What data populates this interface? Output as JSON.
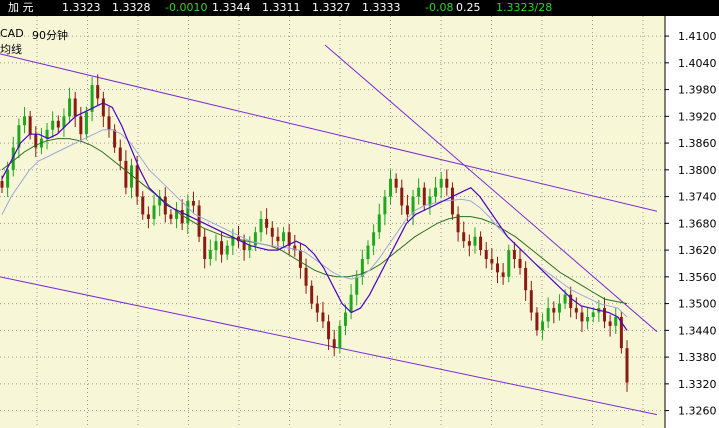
{
  "colors": {
    "background": "#f7f7d8",
    "up_candle": "#1fa81f",
    "down_candle": "#8b1a10",
    "ma_fast": "#4b00c8",
    "ma_mid": "#9fa8d8",
    "ma_slow": "#2b6e1e",
    "channel": "#7b2bd6",
    "header_text": "#ffffff",
    "header_green": "#2bd62b"
  },
  "header": {
    "symbol_cn": "加  元",
    "v1": "1.3323",
    "v2": "1.3328",
    "change": "-0.0010",
    "v3": "1.3344",
    "v4": "1.3311",
    "v5": "1.3327",
    "v6": "1.3333",
    "change_pct": "-0.08",
    "v7": "0.25",
    "v8": "1.3323/28"
  },
  "legend": {
    "pair": "CAD",
    "period": "90分钟",
    "indicator": "均线"
  },
  "chart_data": {
    "type": "candlestick",
    "y_ticks": [
      "1.4100",
      "1.4040",
      "1.3980",
      "1.3920",
      "1.3860",
      "1.3800",
      "1.3740",
      "1.3680",
      "1.3620",
      "1.3560",
      "1.3500",
      "1.3440",
      "1.3380",
      "1.3320",
      "1.3260"
    ],
    "ylim": [
      1.3221,
      1.4145
    ],
    "grid": true,
    "close_series": [
      1.376,
      1.38,
      1.385,
      1.39,
      1.392,
      1.388,
      1.385,
      1.387,
      1.389,
      1.391,
      1.3895,
      1.392,
      1.396,
      1.392,
      1.388,
      1.393,
      1.399,
      1.396,
      1.392,
      1.389,
      1.385,
      1.382,
      1.376,
      1.381,
      1.374,
      1.37,
      1.369,
      1.372,
      1.374,
      1.37,
      1.369,
      1.371,
      1.368,
      1.373,
      1.372,
      1.365,
      1.36,
      1.362,
      1.364,
      1.361,
      1.363,
      1.365,
      1.364,
      1.362,
      1.363,
      1.366,
      1.369,
      1.367,
      1.365,
      1.364,
      1.366,
      1.363,
      1.362,
      1.358,
      1.354,
      1.35,
      1.348,
      1.346,
      1.342,
      1.34,
      1.345,
      1.348,
      1.352,
      1.356,
      1.36,
      1.363,
      1.366,
      1.37,
      1.374,
      1.378,
      1.376,
      1.372,
      1.37,
      1.374,
      1.376,
      1.372,
      1.374,
      1.376,
      1.378,
      1.376,
      1.37,
      1.366,
      1.364,
      1.363,
      1.365,
      1.362,
      1.36,
      1.359,
      1.357,
      1.356,
      1.362,
      1.36,
      1.358,
      1.353,
      1.348,
      1.344,
      1.346,
      1.349,
      1.348,
      1.35,
      1.352,
      1.349,
      1.348,
      1.346,
      1.347,
      1.348,
      1.349,
      1.346,
      1.345,
      1.347,
      1.34,
      1.3323
    ],
    "ma_fast": [
      1.378,
      1.382,
      1.386,
      1.388,
      1.388,
      1.387,
      1.388,
      1.39,
      1.392,
      1.393,
      1.394,
      1.395,
      1.394,
      1.39,
      1.385,
      1.38,
      1.376,
      1.374,
      1.372,
      1.371,
      1.37,
      1.369,
      1.368,
      1.367,
      1.366,
      1.365,
      1.364,
      1.363,
      1.3625,
      1.362,
      1.362,
      1.363,
      1.364,
      1.363,
      1.361,
      1.358,
      1.354,
      1.35,
      1.348,
      1.349,
      1.352,
      1.356,
      1.36,
      1.364,
      1.368,
      1.37,
      1.371,
      1.372,
      1.373,
      1.374,
      1.375,
      1.376,
      1.374,
      1.371,
      1.368,
      1.365,
      1.363,
      1.361,
      1.359,
      1.357,
      1.355,
      1.353,
      1.351,
      1.3495,
      1.349,
      1.3485,
      1.348,
      1.347,
      1.344
    ],
    "ma_mid": [
      1.37,
      1.374,
      1.377,
      1.38,
      1.382,
      1.383,
      1.384,
      1.385,
      1.386,
      1.387,
      1.388,
      1.389,
      1.389,
      1.388,
      1.386,
      1.383,
      1.38,
      1.378,
      1.376,
      1.374,
      1.372,
      1.37,
      1.369,
      1.368,
      1.367,
      1.366,
      1.365,
      1.364,
      1.3635,
      1.363,
      1.3628,
      1.3625,
      1.3622,
      1.3615,
      1.36,
      1.3585,
      1.357,
      1.356,
      1.3555,
      1.356,
      1.3575,
      1.36,
      1.363,
      1.366,
      1.369,
      1.371,
      1.372,
      1.3725,
      1.373,
      1.3732,
      1.3734,
      1.373,
      1.3715,
      1.3695,
      1.367,
      1.365,
      1.363,
      1.361,
      1.359,
      1.3575,
      1.356,
      1.3545,
      1.353,
      1.352,
      1.351,
      1.35,
      1.3495,
      1.349,
      1.347
    ],
    "ma_slow": [
      1.38,
      1.382,
      1.384,
      1.3855,
      1.3865,
      1.387,
      1.387,
      1.3865,
      1.3855,
      1.384,
      1.382,
      1.38,
      1.378,
      1.376,
      1.374,
      1.372,
      1.37,
      1.3685,
      1.367,
      1.366,
      1.365,
      1.3645,
      1.364,
      1.3635,
      1.363,
      1.362,
      1.3605,
      1.359,
      1.3575,
      1.3565,
      1.356,
      1.356,
      1.3565,
      1.3575,
      1.359,
      1.361,
      1.363,
      1.365,
      1.3665,
      1.368,
      1.369,
      1.3695,
      1.3695,
      1.369,
      1.368,
      1.3665,
      1.365,
      1.363,
      1.361,
      1.359,
      1.357,
      1.3555,
      1.354,
      1.3525,
      1.351,
      1.3505,
      1.35
    ]
  }
}
